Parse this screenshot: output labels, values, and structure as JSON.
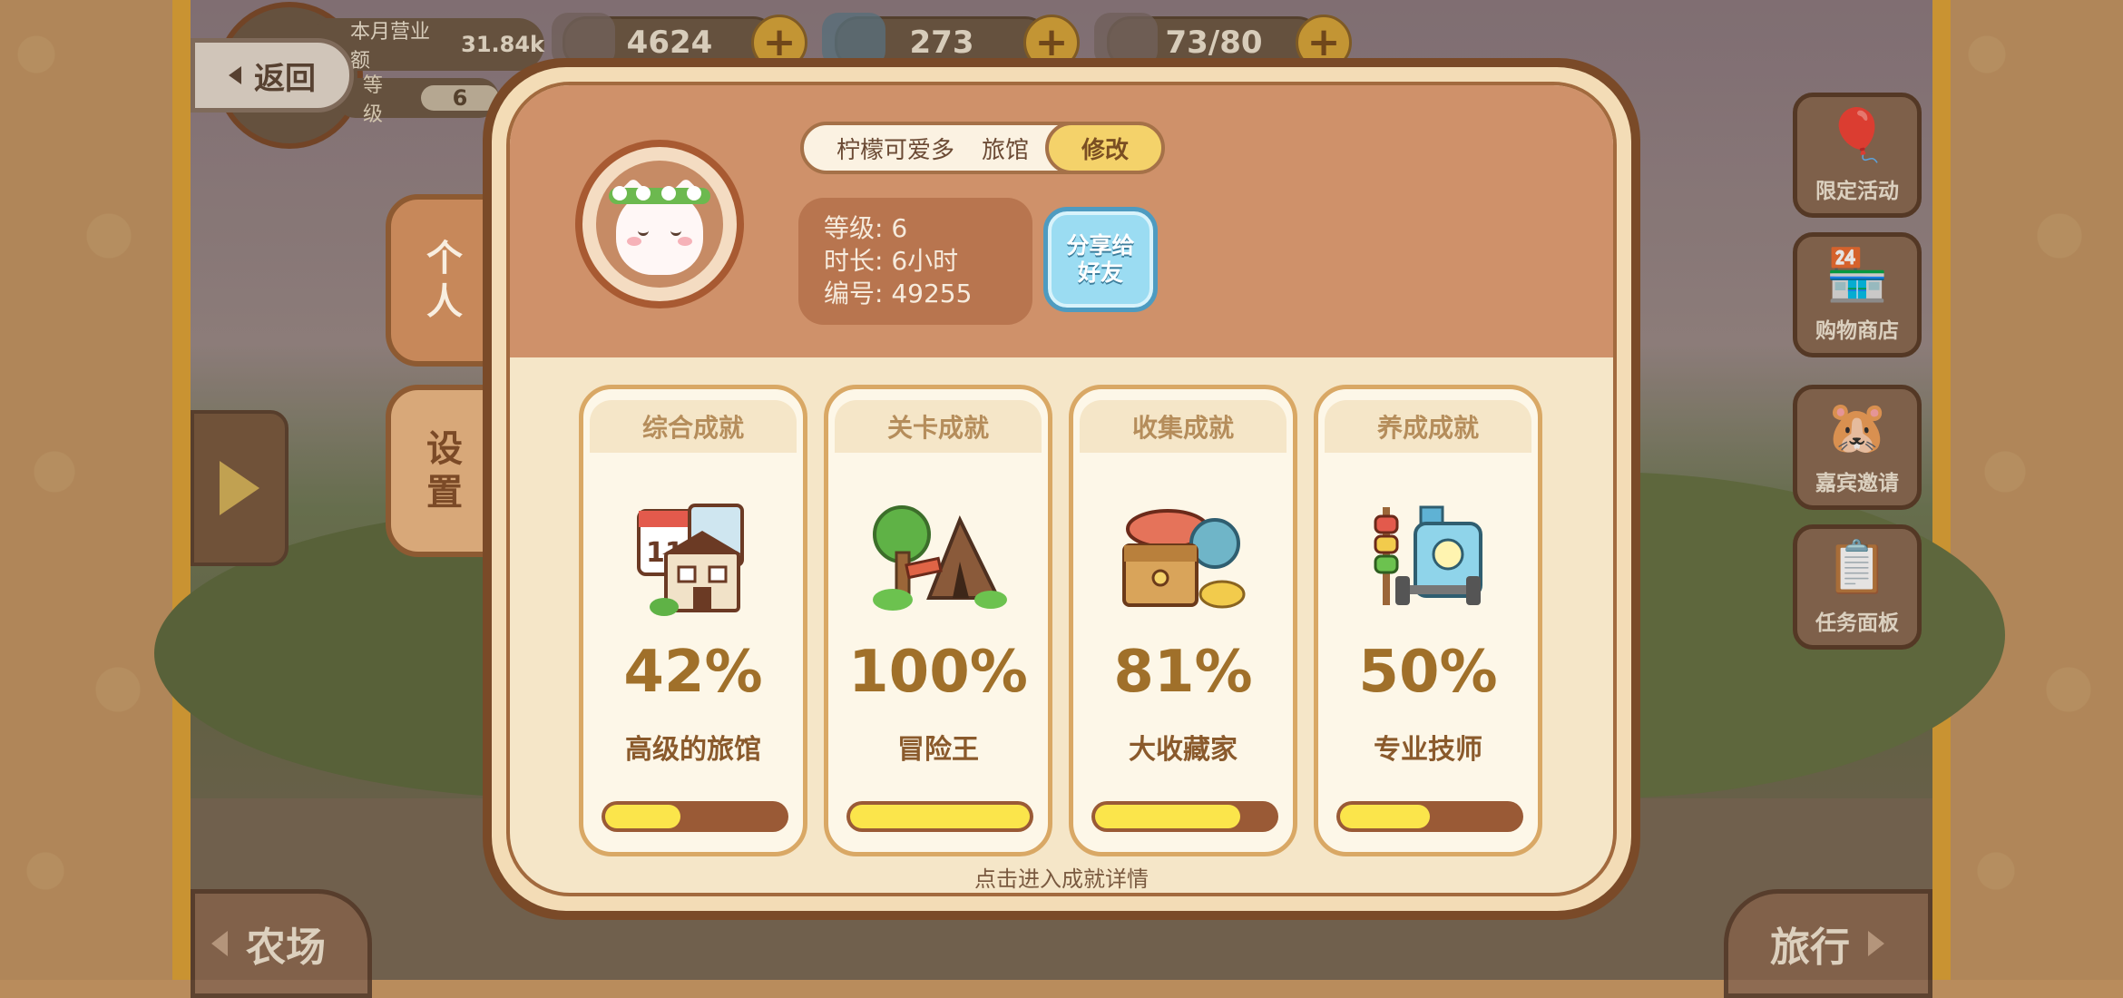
{
  "top_bar": {
    "revenue_label": "本月营业额",
    "revenue_value": "31.84k",
    "level_label": "等级",
    "level_value": "6",
    "fish_coins": "4624",
    "fish": "273",
    "stamina": "73/80",
    "plus": "+"
  },
  "back_label": "返回",
  "side_tabs": {
    "personal": "个\n人",
    "settings": "设\n置"
  },
  "right_menu": [
    {
      "label": "限定活动",
      "icon": "balloon-icon"
    },
    {
      "label": "购物商店",
      "icon": "shop-icon"
    },
    {
      "label": "嘉宾邀请",
      "icon": "guest-icon"
    },
    {
      "label": "任务面板",
      "icon": "task-board-icon"
    }
  ],
  "bottom_nav": {
    "farm": "农场",
    "travel": "旅行"
  },
  "profile": {
    "inn_name": "柠檬可爱多",
    "inn_suffix": "旅馆",
    "edit_label": "修改",
    "level_line": "等级: 6",
    "duration_line": "时长: 6小时",
    "id_line": "编号: 49255",
    "share_label_1": "分享给",
    "share_label_2": "好友"
  },
  "achievements": [
    {
      "title": "综合成就",
      "percent": "42%",
      "progress": 0.42,
      "name": "高级的旅馆",
      "icon": "inn-calendar-icon"
    },
    {
      "title": "关卡成就",
      "percent": "100%",
      "progress": 1.0,
      "name": "冒险王",
      "icon": "adventure-camp-icon"
    },
    {
      "title": "收集成就",
      "percent": "81%",
      "progress": 0.81,
      "name": "大收藏家",
      "icon": "treasure-chest-icon"
    },
    {
      "title": "养成成就",
      "percent": "50%",
      "progress": 0.5,
      "name": "专业技师",
      "icon": "fitness-tools-icon"
    }
  ],
  "hint": "点击进入成就详情",
  "colors": {
    "progress_fill": "#fbe54b",
    "progress_track": "#9a5a36",
    "share_button": "#9bdcf2",
    "edit_button": "#f4d26a"
  }
}
